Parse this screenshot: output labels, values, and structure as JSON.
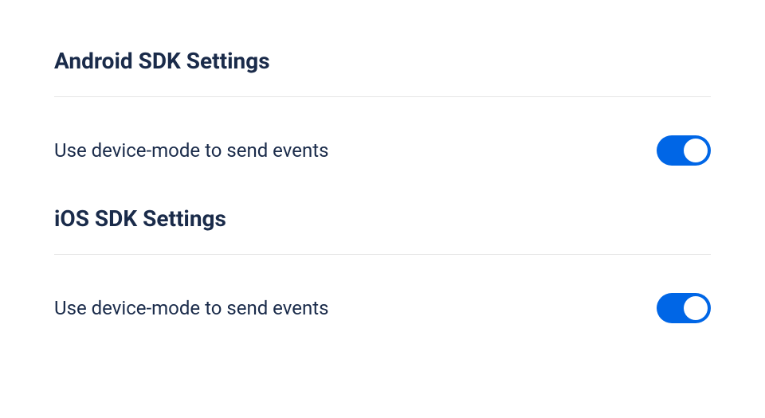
{
  "sections": [
    {
      "title": "Android SDK Settings",
      "setting_label": "Use device-mode to send events",
      "toggle_on": true
    },
    {
      "title": "iOS SDK Settings",
      "setting_label": "Use device-mode to send events",
      "toggle_on": true
    }
  ]
}
